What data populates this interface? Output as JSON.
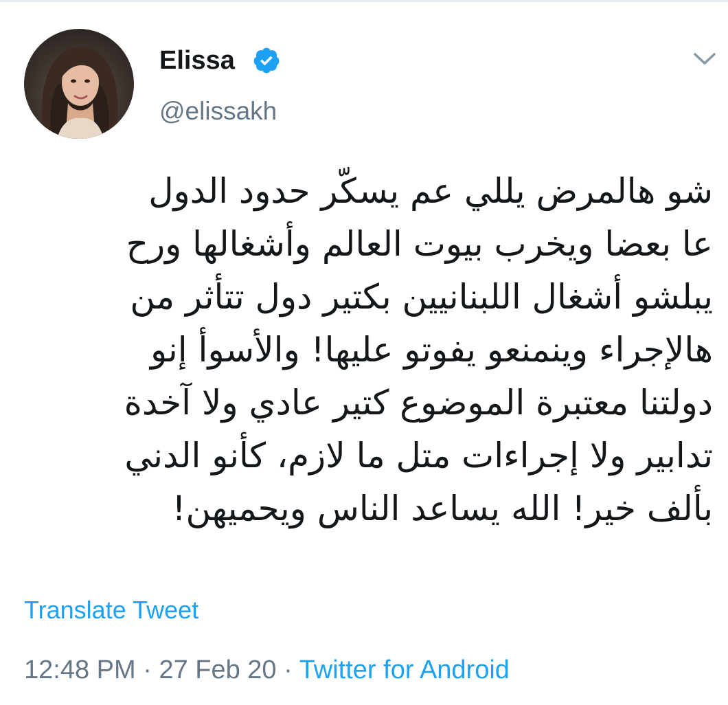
{
  "tweet": {
    "author": {
      "name": "Elissa",
      "handle": "@elissakh",
      "verified": true
    },
    "text_lines": [
      "شو هالمرض يللي عم يسكّر حدود الدول",
      "عا بعضا ويخرب بيوت العالم وأشغالها ورح",
      "يبلشو أشغال اللبنانيين بكتير دول تتأثر من",
      "هالإجراء وينمنعو يفوتو عليها! والأسوأ إنو",
      "دولتنا معتبرة الموضوع كتير عادي ولا آخدة",
      "تدابير ولا إجراءات متل ما لازم، كأنو الدني",
      "بألف خير! الله يساعد الناس ويحميهن!"
    ],
    "translate_label": "Translate Tweet",
    "time": "12:48 PM",
    "date": "27 Feb 20",
    "separator": "·",
    "source": "Twitter for Android"
  },
  "icons": {
    "verified": "verified-badge-icon",
    "chevron": "chevron-down-icon"
  },
  "colors": {
    "accent": "#1da1f2",
    "secondary_text": "#657786",
    "primary_text": "#14171a",
    "divider": "#e6ecf0"
  }
}
